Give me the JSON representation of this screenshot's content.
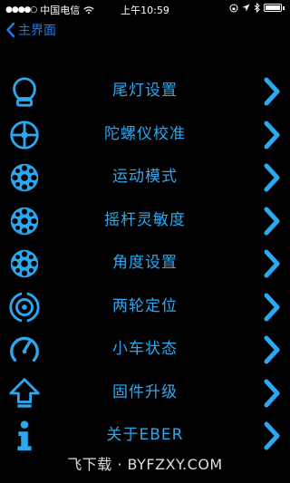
{
  "status_bar": {
    "signal": "●●●●○",
    "carrier": "中国电信",
    "wifi_icon": "wifi-icon",
    "time": "上午10:59",
    "indicators": [
      "lock-rotation-icon",
      "location-arrow-icon",
      "bluetooth-icon",
      "battery-icon"
    ]
  },
  "nav": {
    "back_label": "主界面"
  },
  "menu": {
    "items": [
      {
        "label": "尾灯设置",
        "icon": "tail-light-icon"
      },
      {
        "label": "陀螺仪校准",
        "icon": "gyroscope-icon"
      },
      {
        "label": "运动模式",
        "icon": "motion-mode-icon"
      },
      {
        "label": "摇杆灵敏度",
        "icon": "joystick-sensitivity-icon"
      },
      {
        "label": "角度设置",
        "icon": "angle-settings-icon"
      },
      {
        "label": "两轮定位",
        "icon": "two-wheel-positioning-icon"
      },
      {
        "label": "小车状态",
        "icon": "car-status-gauge-icon"
      },
      {
        "label": "固件升级",
        "icon": "firmware-upgrade-icon"
      },
      {
        "label": "关于EBER",
        "icon": "info-icon"
      }
    ]
  },
  "watermark": "飞下载 · BYFZXY.COM",
  "colors": {
    "accent": "#2ca8f0",
    "back": "#1b7cf4",
    "background": "#000000"
  }
}
